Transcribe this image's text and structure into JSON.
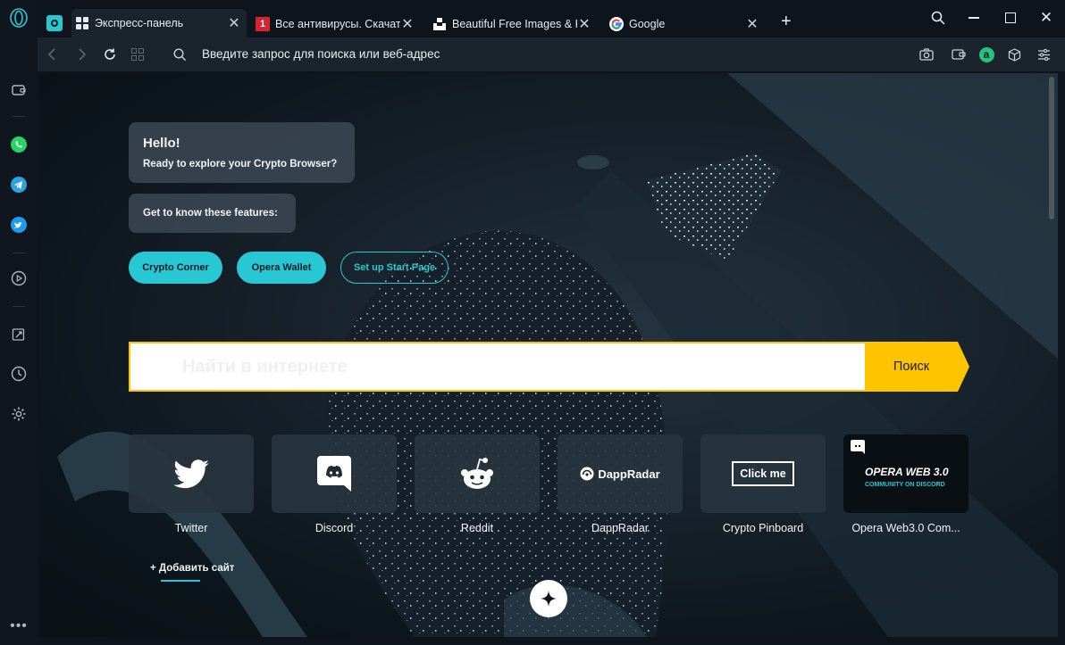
{
  "tabs": [
    {
      "title": "Экспресс-панель",
      "icon": "grid-icon",
      "active": true
    },
    {
      "title": "Все антивирусы. Скачать",
      "icon": "antivirus-favicon"
    },
    {
      "title": "Beautiful Free Images & P",
      "icon": "unsplash-favicon"
    },
    {
      "title": "Google",
      "icon": "google-favicon"
    }
  ],
  "addressbar": {
    "placeholder": "Введите запрос для поиска или веб-адрес"
  },
  "welcome": {
    "hello": "Hello!",
    "subtitle": "Ready to explore your Crypto Browser?",
    "features": "Get to know these features:"
  },
  "feature_buttons": [
    "Crypto Corner",
    "Opera Wallet",
    "Set up Start Page"
  ],
  "search": {
    "placeholder": "Найти в интернете",
    "button": "Поиск"
  },
  "speed_dials": [
    {
      "label": "Twitter",
      "icon": "twitter-icon"
    },
    {
      "label": "Discord",
      "icon": "discord-icon"
    },
    {
      "label": "Reddit",
      "icon": "reddit-icon"
    },
    {
      "label": "DappRadar",
      "icon": "dappradar-logo",
      "logo_text": "DappRadar"
    },
    {
      "label": "Crypto Pinboard",
      "icon": "click-me-logo",
      "logo_text": "Click me"
    },
    {
      "label": "Opera Web3.0 Com...",
      "icon": "discord-icon",
      "logo_text": "OPERA WEB 3.0",
      "logo_sub": "COMMUNITY ON DISCORD"
    }
  ],
  "add_site": "+ Добавить сайт",
  "colors": {
    "accent": "#27c8d3",
    "search_border": "#ffc400",
    "search_button": "#ffc400"
  }
}
